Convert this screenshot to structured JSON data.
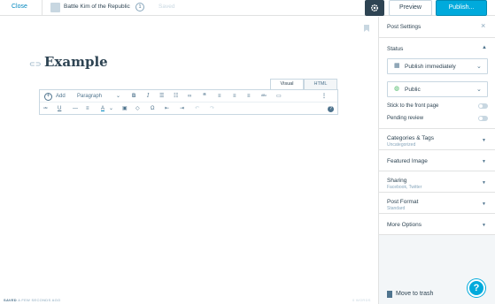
{
  "topbar": {
    "close_label": "Close",
    "site_title": "Battle Kim of the Republic",
    "site_badge": "1",
    "save_status": "Saved",
    "preview_label": "Preview",
    "publish_label": "Publish..."
  },
  "editor": {
    "title": "Example",
    "tabs": [
      "Visual",
      "HTML"
    ],
    "active_tab": "Visual",
    "toolbar": {
      "add_label": "Add",
      "format_select": "Paragraph",
      "bold": "B",
      "italic": "I",
      "quote": "“",
      "omega": "Ω",
      "more": "⋮",
      "help": "?"
    },
    "footer_status_bold": "SAVED",
    "footer_status": "A FEW SECONDS AGO",
    "word_count": "0 WORDS"
  },
  "sidebar": {
    "title": "Post Settings",
    "status_label": "Status",
    "publish_select": "Publish immediately",
    "visibility_select": "Public",
    "stick_label": "Stick to the front page",
    "stick_enabled": false,
    "pending_label": "Pending review",
    "pending_enabled": false,
    "sections": [
      {
        "title": "Categories & Tags",
        "subtitle": "Uncategorized"
      },
      {
        "title": "Featured Image",
        "subtitle": ""
      },
      {
        "title": "Sharing",
        "subtitle": "Facebook, Twitter"
      },
      {
        "title": "Post Format",
        "subtitle": "Standard"
      },
      {
        "title": "More Options",
        "subtitle": ""
      }
    ],
    "trash_label": "Move to trash",
    "help_label": "?"
  },
  "colors": {
    "accent": "#00aadc",
    "link": "#0087be",
    "dark": "#2e4453"
  }
}
